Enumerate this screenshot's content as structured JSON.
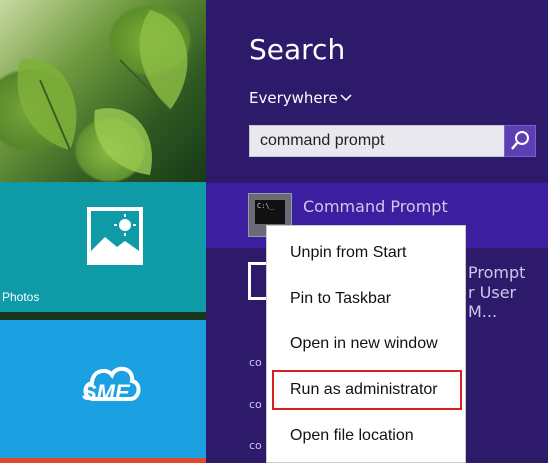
{
  "start_screen": {
    "photos_tile": {
      "label": "Photos",
      "icon": "picture-icon",
      "color": "#0e9aa6"
    },
    "sme_tile": {
      "label": "SME",
      "icon": "cloud-icon",
      "color": "#1ba1e2"
    }
  },
  "search_pane": {
    "title": "Search",
    "scope": "Everywhere",
    "query": "command prompt",
    "search_button_icon": "search-icon",
    "results": [
      {
        "title": "Command Prompt",
        "icon": "command-prompt-icon",
        "icon_text": "C:\\_"
      },
      {
        "title": "Prompt",
        "subtitle": "r User M...",
        "icon": "document-icon"
      }
    ],
    "truncated_rows": [
      "co",
      "co",
      "co"
    ]
  },
  "context_menu": {
    "items": [
      {
        "label": "Unpin from Start"
      },
      {
        "label": "Pin to Taskbar"
      },
      {
        "label": "Open in new window"
      },
      {
        "label": "Run as administrator",
        "highlighted": true
      },
      {
        "label": "Open file location"
      }
    ],
    "highlight_color": "#d62020"
  },
  "colors": {
    "search_bg": "#2d1a6b",
    "selected_row": "#3b1fa0",
    "search_button": "#5e3fb3"
  }
}
